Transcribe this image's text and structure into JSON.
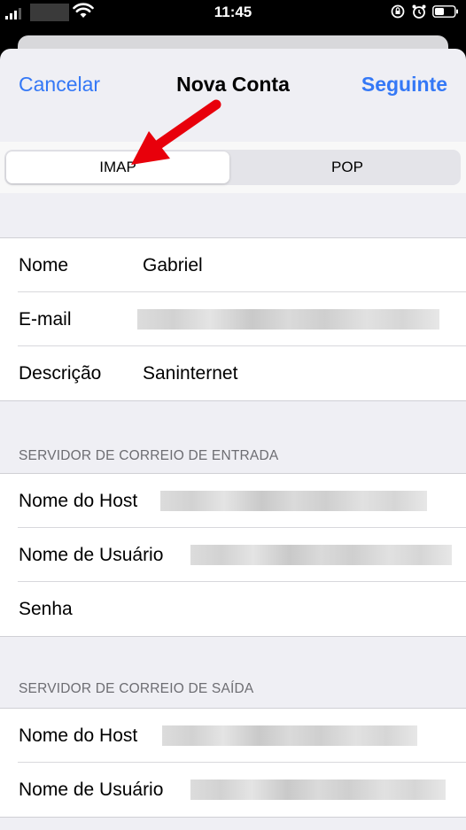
{
  "status_bar": {
    "time": "11:45"
  },
  "nav": {
    "cancel_label": "Cancelar",
    "title": "Nova Conta",
    "next_label": "Seguinte"
  },
  "segment": {
    "options": [
      "IMAP",
      "POP"
    ],
    "selected": "IMAP"
  },
  "account": {
    "name_label": "Nome",
    "name_value": "Gabriel",
    "email_label": "E-mail",
    "description_label": "Descrição",
    "description_value": "Saninternet"
  },
  "incoming": {
    "header": "SERVIDOR DE CORREIO DE ENTRADA",
    "host_label": "Nome do Host",
    "user_label": "Nome de Usuário",
    "password_label": "Senha"
  },
  "outgoing": {
    "header": "SERVIDOR DE CORREIO DE SAÍDA",
    "host_label": "Nome do Host",
    "user_label": "Nome de Usuário"
  },
  "colors": {
    "accent": "#3478f6",
    "annotation_arrow": "#e8000b",
    "grouped_background": "#efeff4"
  }
}
